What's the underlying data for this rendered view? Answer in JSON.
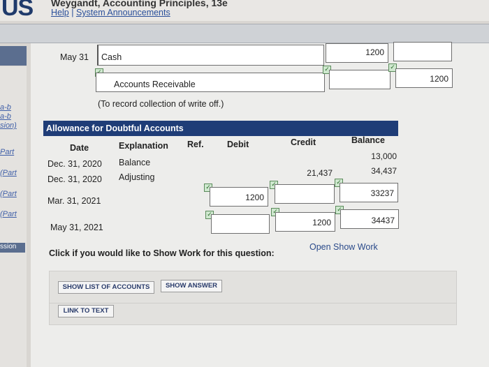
{
  "header": {
    "logo": "US",
    "book_title": "Weygandt, Accounting Principles, 13e",
    "help_link": "Help",
    "separator": "|",
    "announcements_link": "System Announcements"
  },
  "sidebar": {
    "links": [
      "a-b",
      "a-b",
      "sion)",
      "Part",
      "(Part",
      "(Part",
      "(Part"
    ],
    "session_label": "ssion"
  },
  "journal": {
    "date": "May 31",
    "debit_account": "Cash",
    "debit_amount": "1200",
    "credit_account": "Accounts Receivable",
    "credit_amount": "1200",
    "explanation": "(To record collection of write off.)"
  },
  "ledger": {
    "title": "Allowance for Doubtful Accounts",
    "columns": {
      "date": "Date",
      "explanation": "Explanation",
      "ref": "Ref.",
      "debit": "Debit",
      "credit": "Credit",
      "balance": "Balance"
    },
    "rows": [
      {
        "date": "Dec. 31, 2020",
        "explanation": "Balance",
        "credit": "",
        "balance": "13,000"
      },
      {
        "date": "Dec. 31, 2020",
        "explanation": "Adjusting",
        "credit": "21,437",
        "balance": "34,437"
      },
      {
        "date": "Mar. 31, 2021",
        "debit": "1200",
        "balance": "33237"
      },
      {
        "date": "May 31, 2021",
        "credit": "1200",
        "balance": "34437"
      }
    ]
  },
  "show_work": {
    "prompt": "Click if you would like to Show Work for this question:",
    "link": "Open Show Work"
  },
  "buttons": {
    "show_list": "SHOW LIST OF ACCOUNTS",
    "show_answer": "SHOW ANSWER",
    "link_to_text": "LINK TO TEXT"
  }
}
